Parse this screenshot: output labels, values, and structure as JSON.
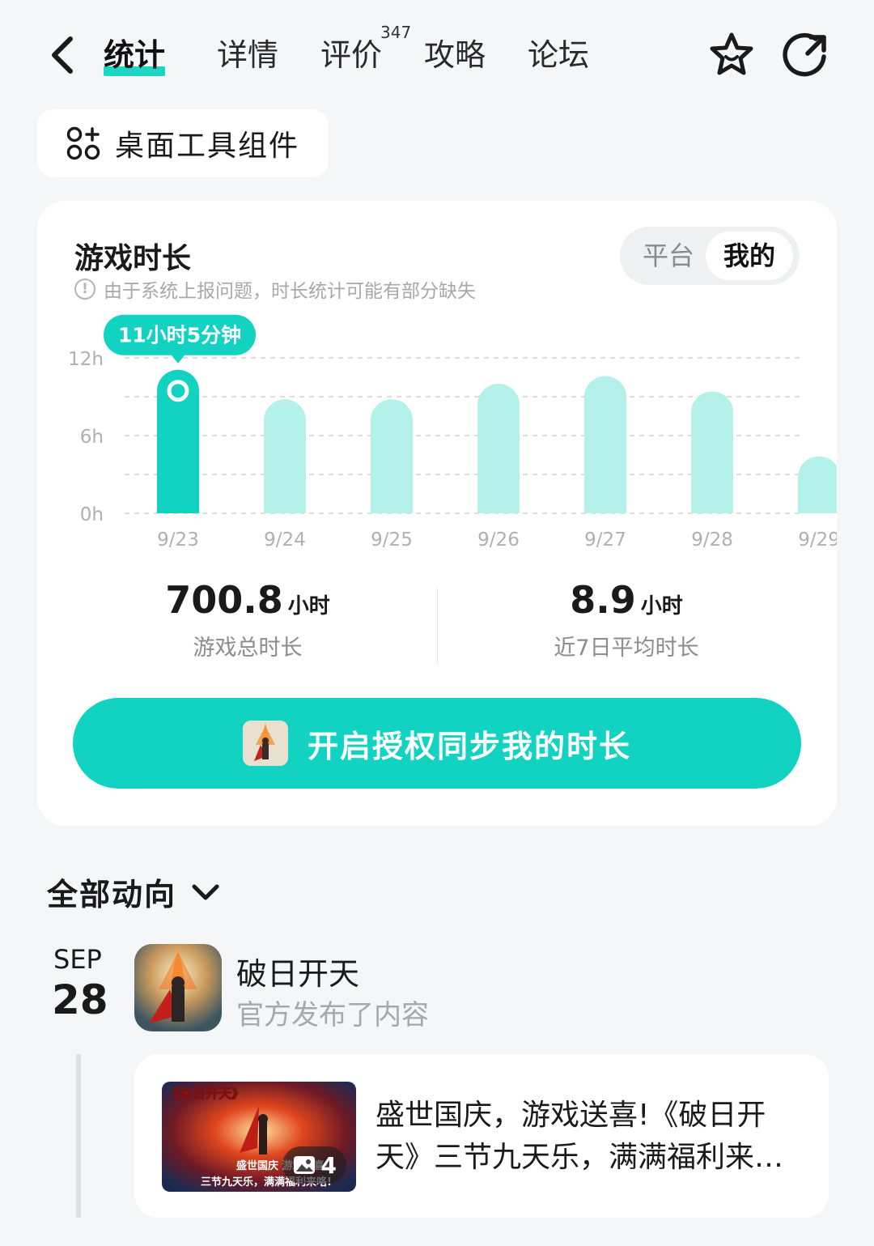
{
  "nav": {
    "tabs": [
      {
        "label": "统计",
        "active": true
      },
      {
        "label": "详情",
        "active": false
      },
      {
        "label": "评价",
        "active": false
      },
      {
        "label": "攻略",
        "active": false
      },
      {
        "label": "论坛",
        "active": false
      }
    ],
    "review_count": "347",
    "icons": [
      "back-icon",
      "star-icon",
      "share-icon"
    ],
    "accent_color": "#1ed6c4"
  },
  "widget_chip": {
    "label": "桌面工具组件",
    "icon": "widget-grid-icon"
  },
  "playtime_card": {
    "title": "游戏时长",
    "note": "由于系统上报问题，时长统计可能有部分缺失",
    "segments": {
      "platform": "平台",
      "mine": "我的",
      "selected": "我的"
    },
    "tooltip": "11小时5分钟",
    "stats": {
      "total_value": "700.8",
      "total_unit": "小时",
      "total_caption": "游戏总时长",
      "avg_value": "8.9",
      "avg_unit": "小时",
      "avg_caption": "近7日平均时长"
    },
    "sync_button": "开启授权同步我的时长"
  },
  "chart_data": {
    "type": "bar",
    "categories": [
      "9/23",
      "9/24",
      "9/25",
      "9/26",
      "9/27",
      "9/28",
      "9/29"
    ],
    "values": [
      11.08,
      8.8,
      8.8,
      10.0,
      10.6,
      9.4,
      4.4
    ],
    "highlighted_index": 0,
    "y_ticks": [
      "0h",
      "6h",
      "12h"
    ],
    "ylim": [
      0,
      12
    ],
    "grid": true,
    "colors": {
      "highlight": "#12d3c2",
      "normal": "#b3f1ea",
      "grid": "#dcdcdc",
      "tick": "#b0b0b0"
    }
  },
  "feed": {
    "filter_label": "全部动向",
    "date_month": "SEP",
    "date_day": "28",
    "author": "破日开天",
    "action": "官方发布了内容",
    "post_title": "盛世国庆，游戏送喜!《破日开天》三节九天乐，满满福利来…",
    "image_count": "4",
    "image_banner": "《破日开天》",
    "image_caption_line1": "盛世国庆 游戏送喜!",
    "image_caption_line2": "三节九天乐，满满福利来咯!"
  }
}
